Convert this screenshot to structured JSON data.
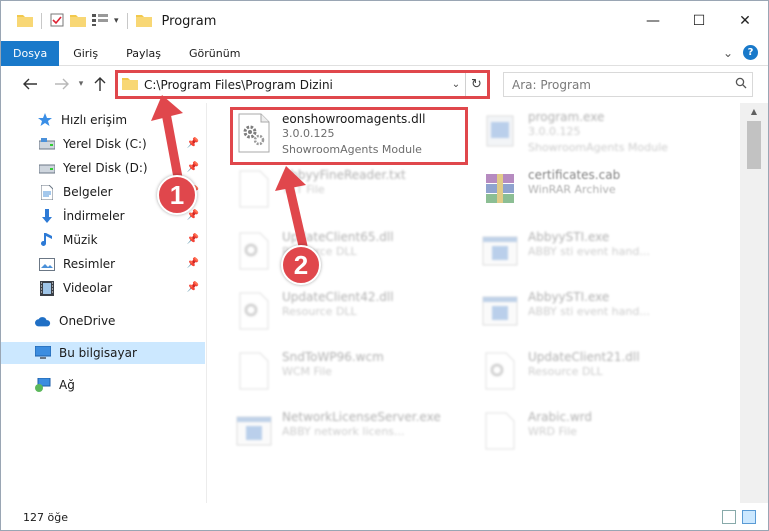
{
  "window": {
    "title": "Program",
    "controls": {
      "minimize": "—",
      "maximize": "☐",
      "close": "✕"
    }
  },
  "ribbon": {
    "tabs": [
      {
        "label": "Dosya",
        "active": true
      },
      {
        "label": "Giriş"
      },
      {
        "label": "Paylaş"
      },
      {
        "label": "Görünüm"
      }
    ],
    "help": "?",
    "collapse": "⌄"
  },
  "address": {
    "path": "C:\\Program Files\\Program Dizini",
    "search_placeholder": "Ara: Program"
  },
  "nav": {
    "items": [
      {
        "label": "Hızlı erişim",
        "icon": "star-icon"
      },
      {
        "label": "Yerel Disk (C:)",
        "icon": "drive-icon",
        "pinned": true
      },
      {
        "label": "Yerel Disk (D:)",
        "icon": "drive-icon",
        "pinned": true
      },
      {
        "label": "Belgeler",
        "icon": "documents-icon",
        "pinned": true
      },
      {
        "label": "İndirmeler",
        "icon": "download-icon",
        "pinned": true
      },
      {
        "label": "Müzik",
        "icon": "music-icon",
        "pinned": true
      },
      {
        "label": "Resimler",
        "icon": "pictures-icon",
        "pinned": true
      },
      {
        "label": "Videolar",
        "icon": "videos-icon",
        "pinned": true
      },
      {
        "label": "OneDrive",
        "icon": "cloud-icon"
      },
      {
        "label": "Bu bilgisayar",
        "icon": "computer-icon",
        "selected": true
      },
      {
        "label": "Ağ",
        "icon": "network-icon"
      }
    ]
  },
  "files": [
    {
      "name": "eonshowroomagents.dll",
      "line1": "3.0.0.125",
      "line2": "ShowroomAgents Module",
      "icon": "dll-gear-icon",
      "focus": true
    },
    {
      "name": "program.exe",
      "line1": "3.0.0.125",
      "line2": "ShowroomAgents Module",
      "icon": "exe-icon"
    },
    {
      "name": "AbbyyFineReader.txt",
      "line1": "TXT File",
      "line2": "",
      "icon": "text-file-icon"
    },
    {
      "name": "certificates.cab",
      "line1": "WinRAR Archive",
      "line2": "",
      "icon": "winrar-icon"
    },
    {
      "name": "UpdateClient65.dll",
      "line1": "Resource DLL",
      "line2": "",
      "icon": "dll-gear-icon"
    },
    {
      "name": "AbbyySTI.exe",
      "line1": "ABBY sti event hand...",
      "line2": "",
      "icon": "exe-icon"
    },
    {
      "name": "UpdateClient42.dll",
      "line1": "Resource DLL",
      "line2": "",
      "icon": "dll-gear-icon"
    },
    {
      "name": "AbbyySTI.exe",
      "line1": "ABBY sti event hand...",
      "line2": "",
      "icon": "exe-icon"
    },
    {
      "name": "SndToWP96.wcm",
      "line1": "WCM File",
      "line2": "",
      "icon": "blank-file-icon"
    },
    {
      "name": "UpdateClient21.dll",
      "line1": "Resource DLL",
      "line2": "",
      "icon": "dll-gear-icon"
    },
    {
      "name": "NetworkLicenseServer.exe",
      "line1": "ABBY network licens...",
      "line2": "",
      "icon": "exe-icon"
    },
    {
      "name": "Arabic.wrd",
      "line1": "WRD File",
      "line2": "",
      "icon": "blank-file-icon"
    }
  ],
  "status": {
    "count": "127 öğe"
  },
  "annotations": {
    "callout1": "1",
    "callout2": "2"
  },
  "colors": {
    "accent": "#1979ca",
    "highlight": "#e0474c",
    "selection": "#cce8ff"
  }
}
